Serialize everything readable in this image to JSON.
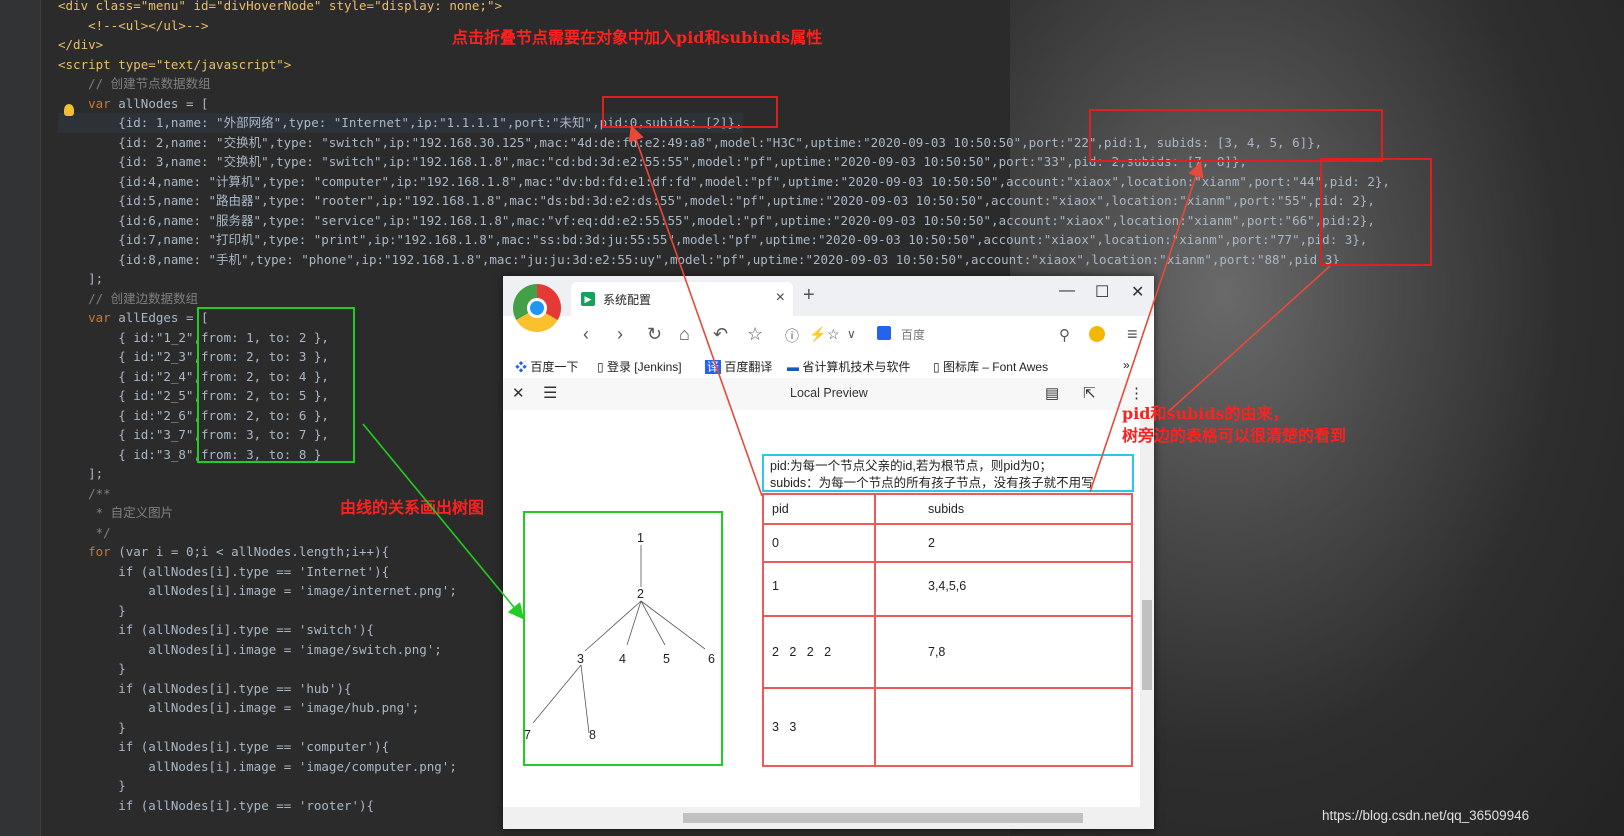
{
  "annotations": {
    "top": "点击折叠节点需要在对象中加入pid和subinds属性",
    "tree_label": "由线的关系画出树图",
    "origin_line1": "pid和subids的由来，",
    "origin_line2": "树旁边的表格可以很清楚的看到"
  },
  "editor": {
    "line_numbers": [
      "",
      "",
      "",
      "",
      "",
      "",
      "",
      "",
      "",
      "",
      "",
      "",
      "",
      "",
      "",
      "",
      "",
      "",
      "",
      "",
      "",
      "",
      "",
      "",
      "",
      "",
      "",
      "",
      "",
      "",
      "",
      "",
      "",
      "",
      "",
      "",
      "",
      "",
      "",
      ""
    ],
    "lines": [
      "<div class=\"menu\" id=\"divHoverNode\" style=\"display: none;\">",
      "    <!--<ul></ul>-->",
      "</div>",
      "<script type=\"text/javascript\">",
      "    // 创建节点数据数组",
      "    var allNodes = [",
      "        {id: 1,name: \"外部网络\",type: \"Internet\",ip:\"1.1.1.1\",port:\"未知\",pid:0,subids: [2]},",
      "        {id: 2,name: \"交换机\",type: \"switch\",ip:\"192.168.30.125\",mac:\"4d:de:fd:e2:49:a8\",model:\"H3C\",uptime:\"2020-09-03 10:50:50\",port:\"22\",pid:1, subids: [3, 4, 5, 6]},",
      "        {id: 3,name: \"交换机\",type: \"switch\",ip:\"192.168.1.8\",mac:\"cd:bd:3d:e2:55:55\",model:\"pf\",uptime:\"2020-09-03 10:50:50\",port:\"33\",pid: 2,subids: [7, 8]},",
      "        {id:4,name: \"计算机\",type: \"computer\",ip:\"192.168.1.8\",mac:\"dv:bd:fd:e1:df:fd\",model:\"pf\",uptime:\"2020-09-03 10:50:50\",account:\"xiaox\",location:\"xianm\",port:\"44\",pid: 2},",
      "        {id:5,name: \"路由器\",type: \"rooter\",ip:\"192.168.1.8\",mac:\"ds:bd:3d:e2:ds:55\",model:\"pf\",uptime:\"2020-09-03 10:50:50\",account:\"xiaox\",location:\"xianm\",port:\"55\",pid: 2},",
      "        {id:6,name: \"服务器\",type: \"service\",ip:\"192.168.1.8\",mac:\"vf:eq:dd:e2:55:55\",model:\"pf\",uptime:\"2020-09-03 10:50:50\",account:\"xiaox\",location:\"xianm\",port:\"66\",pid:2},",
      "        {id:7,name: \"打印机\",type: \"print\",ip:\"192.168.1.8\",mac:\"ss:bd:3d:ju:55:55\",model:\"pf\",uptime:\"2020-09-03 10:50:50\",account:\"xiaox\",location:\"xianm\",port:\"77\",pid: 3},",
      "        {id:8,name: \"手机\",type: \"phone\",ip:\"192.168.1.8\",mac:\"ju:ju:3d:e2:55:uy\",model:\"pf\",uptime:\"2020-09-03 10:50:50\",account:\"xiaox\",location:\"xianm\",port:\"88\",pid:3}",
      "    ];",
      "    // 创建边数据数组",
      "    var allEdges = [",
      "        { id:\"1_2\",from: 1, to: 2 },",
      "        { id:\"2_3\",from: 2, to: 3 },",
      "        { id:\"2_4\",from: 2, to: 4 },",
      "        { id:\"2_5\",from: 2, to: 5 },",
      "        { id:\"2_6\",from: 2, to: 6 },",
      "        { id:\"3_7\",from: 3, to: 7 },",
      "        { id:\"3_8\",from: 3, to: 8 }",
      "    ];",
      "    /**",
      "     * 自定义图片",
      "     */",
      "    for (var i = 0;i < allNodes.length;i++){",
      "        if (allNodes[i].type == 'Internet'){",
      "            allNodes[i].image = 'image/internet.png';",
      "        }",
      "        if (allNodes[i].type == 'switch'){",
      "            allNodes[i].image = 'image/switch.png';",
      "        }",
      "        if (allNodes[i].type == 'hub'){",
      "            allNodes[i].image = 'image/hub.png';",
      "        }",
      "        if (allNodes[i].type == 'computer'){",
      "            allNodes[i].image = 'image/computer.png';",
      "        }",
      "        if (allNodes[i].type == 'rooter'){"
    ]
  },
  "browser": {
    "tab_title": "系统配置",
    "new_tab": "+",
    "address_placeholder": "百度",
    "bookmarks": [
      "百度一下",
      "登录 [Jenkins]",
      "百度翻译",
      "省计算机技术与软件",
      "图标库 – Font Awes"
    ],
    "bookmarks_more": "»",
    "preview_title": "Local Preview",
    "desc_line1": "pid:为每一个节点父亲的id,若为根节点，则pid为0；",
    "desc_line2": "subids：为每一个节点的所有孩子节点，没有孩子就不用写",
    "table": {
      "headers": [
        "pid",
        "subids"
      ],
      "rows": [
        [
          "0",
          "2"
        ],
        [
          "1",
          "3,4,5,6"
        ],
        [
          "2   2   2   2",
          "7,8"
        ],
        [
          "3   3",
          ""
        ]
      ]
    },
    "tree_nodes": [
      "1",
      "2",
      "3",
      "4",
      "5",
      "6",
      "7",
      "8"
    ]
  },
  "watermark": "https://blog.csdn.net/qq_36509946"
}
